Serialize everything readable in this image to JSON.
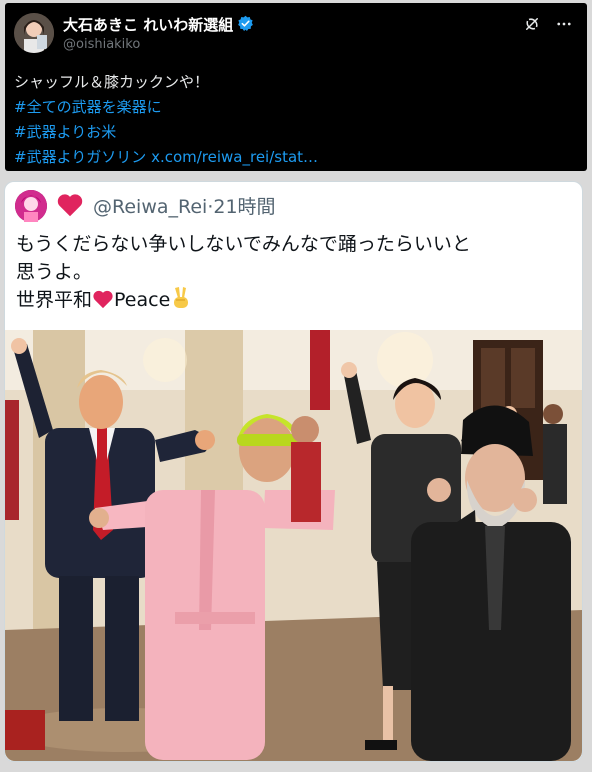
{
  "tweet": {
    "display_name": "大石あきこ れいわ新選組",
    "handle": "@oishiakiko",
    "lines": [
      "シャッフル＆膝カックンや！"
    ],
    "hashtags": [
      "#全ての武器を楽器に",
      "#武器よりお米",
      "#武器よりガソリン"
    ],
    "link": "x.com/reiwa_rei/stat…"
  },
  "icons": {
    "verified": "verified-badge-icon",
    "grok": "grok-icon",
    "more": "more-options-icon"
  },
  "quote": {
    "handle": "@Reiwa_Rei",
    "separator": "·",
    "time": "21時間",
    "line1": "もうくだらない争いしないでみんなで踊ったらいいと",
    "line2": "思うよ。",
    "line3_a": "世界平和",
    "line3_b": "Peace"
  },
  "colors": {
    "accent": "#1d9bf0",
    "dark_bg": "#000000",
    "heart": "#e0245e"
  }
}
